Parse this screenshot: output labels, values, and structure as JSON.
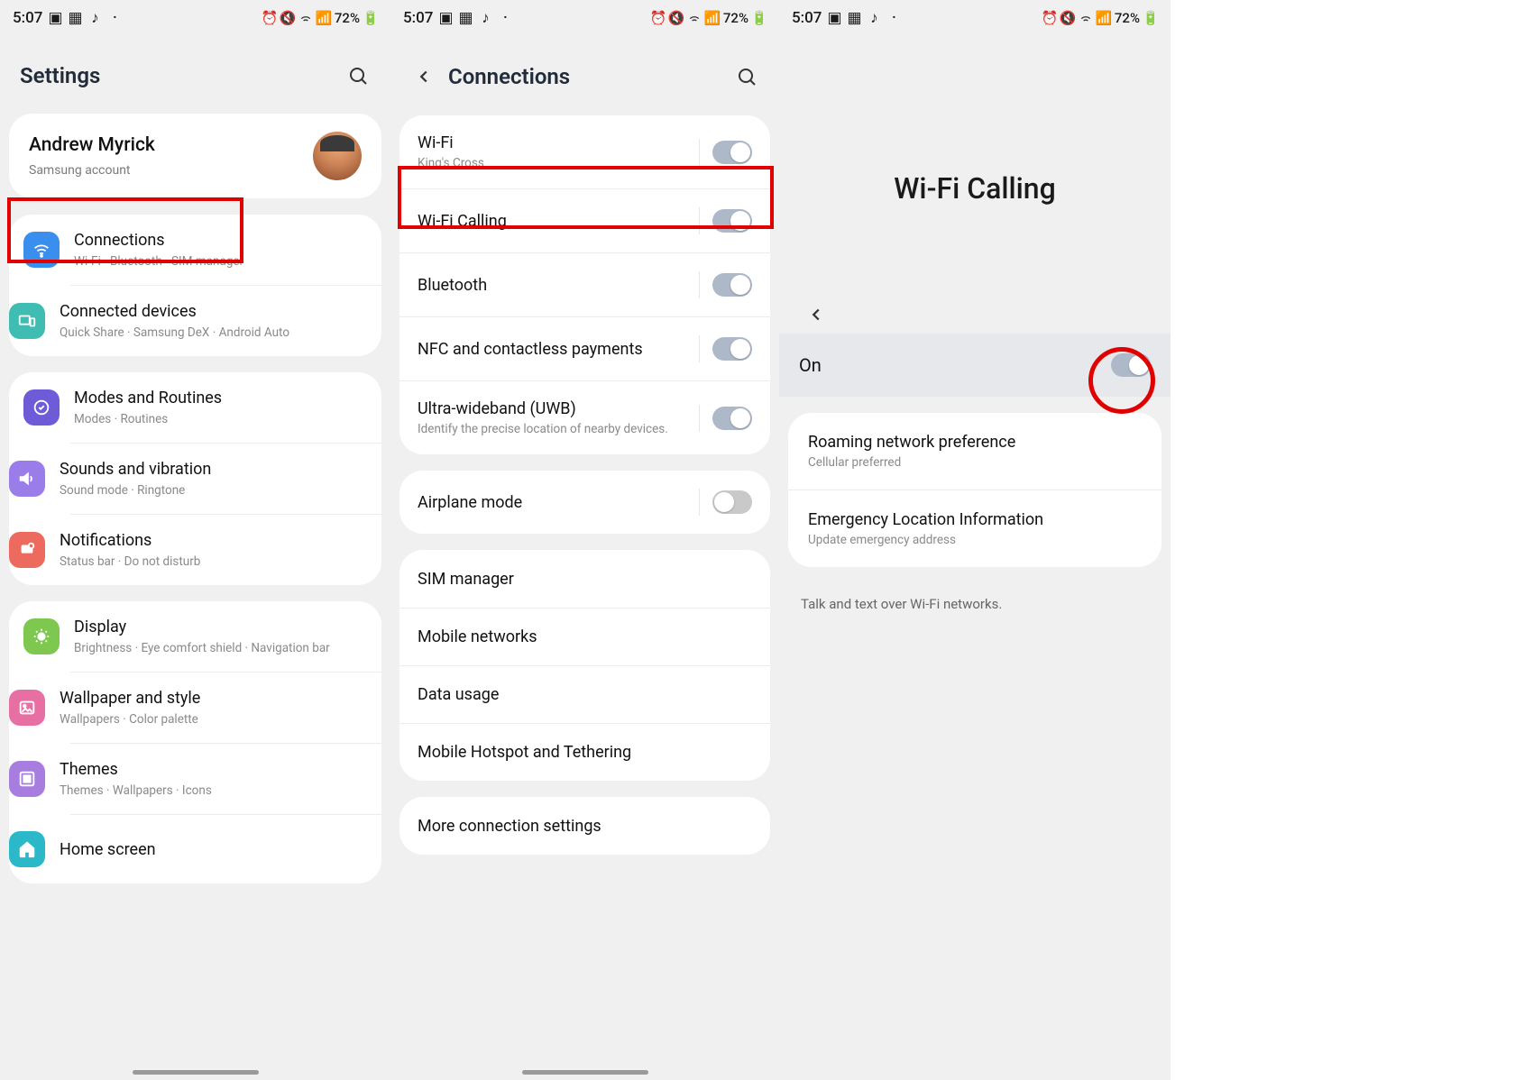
{
  "status": {
    "time": "5:07",
    "battery": "72%"
  },
  "panel1": {
    "title": "Settings",
    "account": {
      "name": "Andrew Myrick",
      "sub": "Samsung account"
    },
    "groups": [
      {
        "items": [
          {
            "title": "Connections",
            "sub": "Wi-Fi · Bluetooth · SIM manager",
            "color": "ic-blue",
            "icon": "wifi"
          },
          {
            "title": "Connected devices",
            "sub": "Quick Share · Samsung DeX · Android Auto",
            "color": "ic-teal",
            "icon": "devices"
          }
        ]
      },
      {
        "items": [
          {
            "title": "Modes and Routines",
            "sub": "Modes · Routines",
            "color": "ic-purple",
            "icon": "routines"
          },
          {
            "title": "Sounds and vibration",
            "sub": "Sound mode · Ringtone",
            "color": "ic-purple2",
            "icon": "sound"
          },
          {
            "title": "Notifications",
            "sub": "Status bar · Do not disturb",
            "color": "ic-coral",
            "icon": "notif"
          }
        ]
      },
      {
        "items": [
          {
            "title": "Display",
            "sub": "Brightness · Eye comfort shield · Navigation bar",
            "color": "ic-green",
            "icon": "display"
          },
          {
            "title": "Wallpaper and style",
            "sub": "Wallpapers · Color palette",
            "color": "ic-pink",
            "icon": "wallpaper"
          },
          {
            "title": "Themes",
            "sub": "Themes · Wallpapers · Icons",
            "color": "ic-violet",
            "icon": "themes"
          },
          {
            "title": "Home screen",
            "sub": "",
            "color": "ic-cyan",
            "icon": "home"
          }
        ]
      }
    ]
  },
  "panel2": {
    "title": "Connections",
    "groups": [
      {
        "items": [
          {
            "title": "Wi-Fi",
            "sub": "King's Cross",
            "toggle": "on"
          },
          {
            "title": "Wi-Fi Calling",
            "sub": "",
            "toggle": "on"
          },
          {
            "title": "Bluetooth",
            "sub": "",
            "toggle": "on"
          },
          {
            "title": "NFC and contactless payments",
            "sub": "",
            "toggle": "on"
          },
          {
            "title": "Ultra-wideband (UWB)",
            "sub": "Identify the precise location of nearby devices.",
            "toggle": "on"
          }
        ]
      },
      {
        "items": [
          {
            "title": "Airplane mode",
            "sub": "",
            "toggle": "off"
          }
        ]
      },
      {
        "items": [
          {
            "title": "SIM manager",
            "sub": "",
            "toggle": ""
          },
          {
            "title": "Mobile networks",
            "sub": "",
            "toggle": ""
          },
          {
            "title": "Data usage",
            "sub": "",
            "toggle": ""
          },
          {
            "title": "Mobile Hotspot and Tethering",
            "sub": "",
            "toggle": ""
          }
        ]
      },
      {
        "items": [
          {
            "title": "More connection settings",
            "sub": "",
            "toggle": ""
          }
        ]
      }
    ]
  },
  "panel3": {
    "big_title": "Wi-Fi Calling",
    "on_label": "On",
    "items": [
      {
        "title": "Roaming network preference",
        "sub": "Cellular preferred"
      },
      {
        "title": "Emergency Location Information",
        "sub": "Update emergency address"
      }
    ],
    "footer": "Talk and text over Wi-Fi networks."
  }
}
